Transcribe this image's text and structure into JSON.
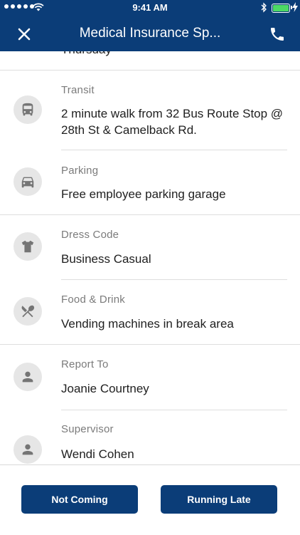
{
  "status_bar": {
    "time": "9:41 AM"
  },
  "header": {
    "title": "Medical Insurance Sp..."
  },
  "partial_text": "Thursday",
  "rows": [
    {
      "label": "Transit",
      "value": "2 minute walk from 32 Bus Route Stop @ 28th St & Camelback Rd.",
      "icon": "bus-icon"
    },
    {
      "label": "Parking",
      "value": "Free employee parking garage",
      "icon": "car-icon"
    },
    {
      "label": "Dress Code",
      "value": "Business Casual",
      "icon": "shirt-icon"
    },
    {
      "label": "Food & Drink",
      "value": "Vending machines in break area",
      "icon": "fork-knife-icon"
    },
    {
      "label": "Report To",
      "value": "Joanie Courtney",
      "icon": "person-icon"
    },
    {
      "label": "Supervisor",
      "value": "Wendi Cohen",
      "icon": "person-icon"
    }
  ],
  "footer": {
    "not_coming_label": "Not Coming",
    "running_late_label": "Running Late"
  },
  "colors": {
    "primary": "#0b3d78",
    "icon_bg": "#e6e6e6",
    "label": "#7b7b7b",
    "battery": "#4cd964"
  }
}
